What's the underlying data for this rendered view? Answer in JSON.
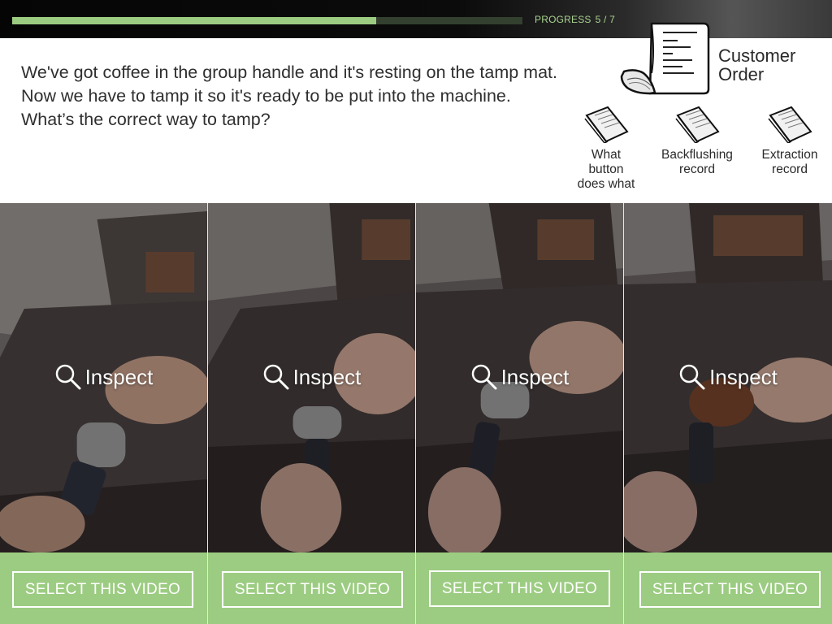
{
  "progress": {
    "label": "PROGRESS",
    "count_text": "5 / 7",
    "current": 5,
    "total": 7,
    "fill_fraction": 0.714
  },
  "question": {
    "lines": [
      "We've got coffee in the group handle and it's resting on the tamp mat.",
      "Now we have to tamp it so it's ready to be put into the machine.",
      "What’s the correct way to tamp?"
    ]
  },
  "documents": {
    "customer_order": {
      "line1": "Customer",
      "line2": "Order"
    },
    "items": [
      {
        "lines": [
          "What",
          "button",
          "does what"
        ]
      },
      {
        "lines": [
          "Backflushing",
          "record"
        ]
      },
      {
        "lines": [
          "Extraction",
          "record"
        ]
      }
    ]
  },
  "videos": [
    {
      "inspect_label": "Inspect",
      "select_label": "SELECT THIS VIDEO"
    },
    {
      "inspect_label": "Inspect",
      "select_label": "SELECT THIS VIDEO"
    },
    {
      "inspect_label": "Inspect",
      "select_label": "SELECT THIS VIDEO"
    },
    {
      "inspect_label": "Inspect",
      "select_label": "SELECT THIS VIDEO"
    }
  ],
  "colors": {
    "accent_green": "#9ccc82",
    "progress_track": "#33402f",
    "text": "#2f2f2f"
  },
  "icons": {
    "customer_order": "receipt-icon",
    "documents": "paper-slip-icon",
    "inspect": "magnifier-icon"
  }
}
